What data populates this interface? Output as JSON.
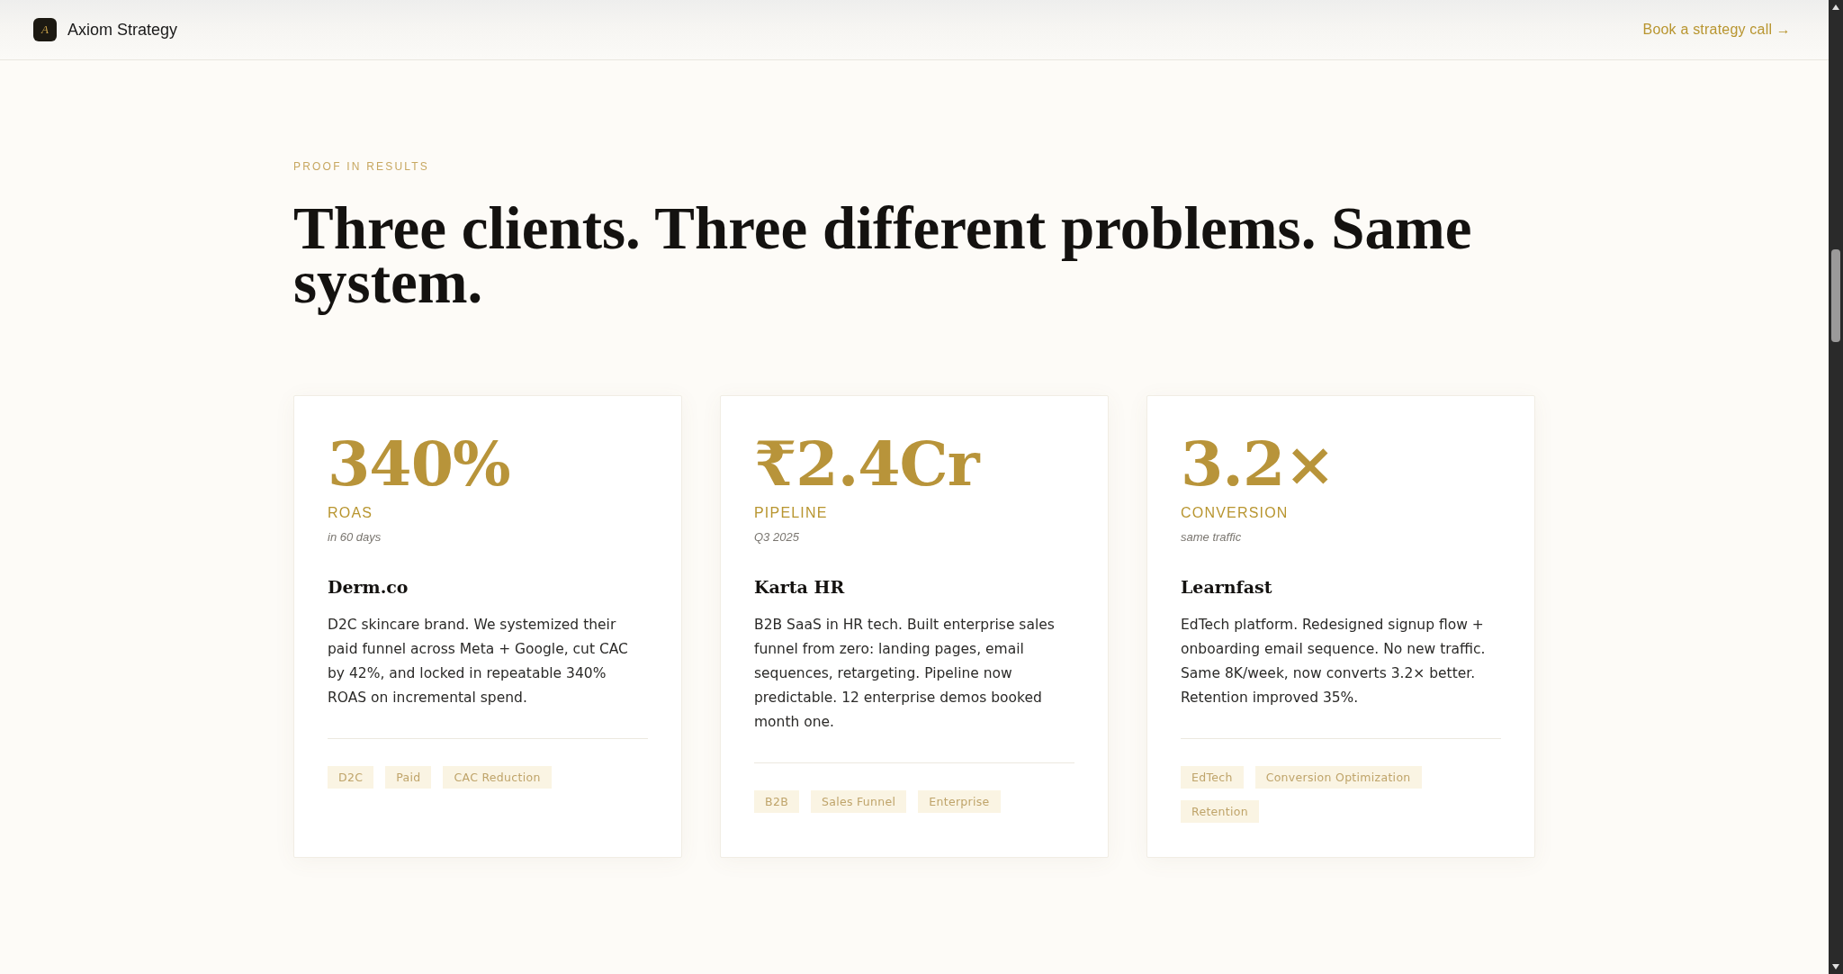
{
  "header": {
    "logo": {
      "mark": "A",
      "name": "Axiom Strategy"
    },
    "cta": "Book a strategy call →"
  },
  "section": {
    "eyebrow": "PROOF IN RESULTS",
    "heading": "Three clients. Three different problems. Same system.",
    "cards": [
      {
        "metric": "340%",
        "metric_label": "ROAS",
        "metric_note": "in 60 days",
        "client": "Derm.co",
        "description": "D2C skincare brand. We systemized their paid funnel across Meta + Google, cut CAC by 42%, and locked in repeatable 340% ROAS on incremental spend.",
        "tags": [
          "D2C",
          "Paid",
          "CAC Reduction"
        ]
      },
      {
        "metric": "₹2.4Cr",
        "metric_label": "PIPELINE",
        "metric_note": "Q3 2025",
        "client": "Karta HR",
        "description": "B2B SaaS in HR tech. Built enterprise sales funnel from zero: landing pages, email sequences, retargeting. Pipeline now predictable. 12 enterprise demos booked month one.",
        "tags": [
          "B2B",
          "Sales Funnel",
          "Enterprise"
        ]
      },
      {
        "metric": "3.2×",
        "metric_label": "CONVERSION",
        "metric_note": "same traffic",
        "client": "Learnfast",
        "description": "EdTech platform. Redesigned signup flow + onboarding email sequence. No new traffic. Same 8K/week, now converts 3.2× better. Retention improved 35%.",
        "tags": [
          "EdTech",
          "Conversion Optimization",
          "Retention"
        ]
      }
    ]
  }
}
